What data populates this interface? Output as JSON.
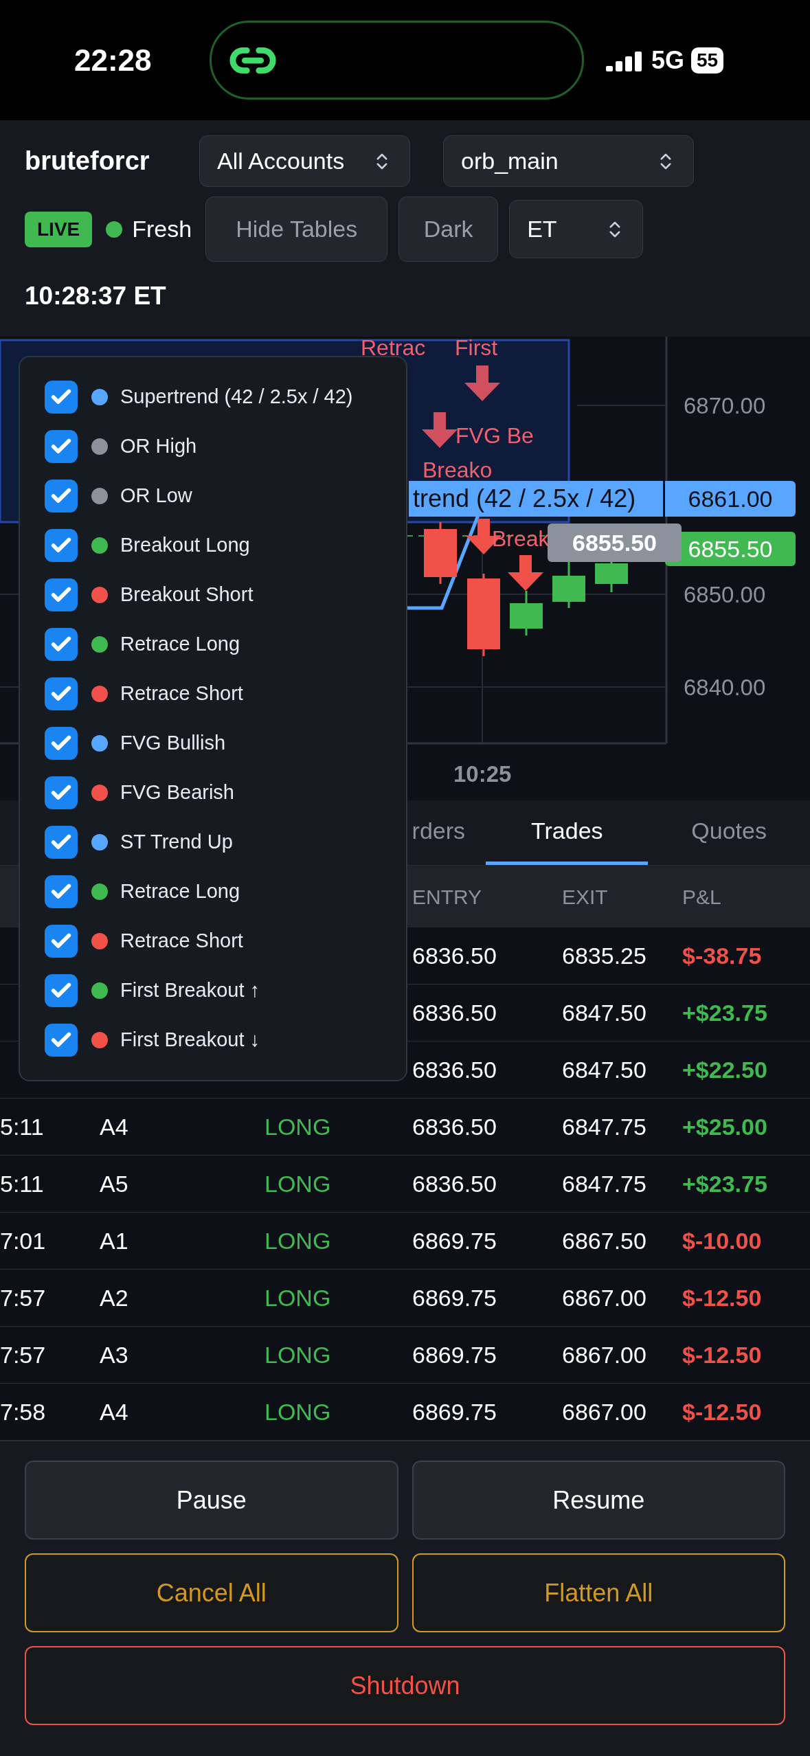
{
  "status_bar": {
    "time": "22:28",
    "network": "5G",
    "battery": "55"
  },
  "header": {
    "title": "bruteforcr",
    "account_select": "All Accounts",
    "strategy_select": "orb_main",
    "live_badge": "LIVE",
    "feed_status": "Fresh",
    "buttons": [
      "Hide Tables",
      "Dark"
    ],
    "timezone_select": "ET",
    "clock": "10:28:37 ET"
  },
  "chart": {
    "price_labels": [
      "6870.00",
      "6850.00",
      "6840.00"
    ],
    "x_labels": [
      "10:25"
    ],
    "supertrend_label": "trend (42 / 2.5x / 42)",
    "supertrend_price": "6861.00",
    "last_price": "6855.50",
    "crosshair_price": "6855.50",
    "markers": [
      "Retrac",
      "First",
      "FVG Be",
      "Breako",
      "Break"
    ]
  },
  "legend": {
    "items": [
      {
        "label": "Supertrend (42 / 2.5x / 42)",
        "color": "#58a6ff",
        "checked": true
      },
      {
        "label": "OR High",
        "color": "#8b929b",
        "checked": true
      },
      {
        "label": "OR Low",
        "color": "#8b929b",
        "checked": true
      },
      {
        "label": "Breakout Long",
        "color": "#3fb950",
        "checked": true
      },
      {
        "label": "Breakout Short",
        "color": "#f05249",
        "checked": true
      },
      {
        "label": "Retrace Long",
        "color": "#3fb950",
        "checked": true
      },
      {
        "label": "Retrace Short",
        "color": "#f05249",
        "checked": true
      },
      {
        "label": "FVG Bullish",
        "color": "#58a6ff",
        "checked": true
      },
      {
        "label": "FVG Bearish",
        "color": "#f05249",
        "checked": true
      },
      {
        "label": "ST Trend Up",
        "color": "#58a6ff",
        "checked": true
      },
      {
        "label": "Retrace Long",
        "color": "#3fb950",
        "checked": true
      },
      {
        "label": "Retrace Short",
        "color": "#f05249",
        "checked": true
      },
      {
        "label": "First Breakout ↑",
        "color": "#3fb950",
        "checked": true
      },
      {
        "label": "First Breakout ↓",
        "color": "#f05249",
        "checked": true
      }
    ]
  },
  "tabs": [
    {
      "label": "rders",
      "selected": false
    },
    {
      "label": "Trades",
      "selected": true
    },
    {
      "label": "Quotes",
      "selected": false
    }
  ],
  "table": {
    "columns": [
      "ENTRY",
      "EXIT",
      "P&L"
    ],
    "rows": [
      {
        "entry": "6836.50",
        "exit": "6835.25",
        "pnl": "$-38.75",
        "kind": "loss"
      },
      {
        "entry": "6836.50",
        "exit": "6847.50",
        "pnl": "+$23.75",
        "kind": "gain"
      },
      {
        "entry": "6836.50",
        "exit": "6847.50",
        "pnl": "+$22.50",
        "kind": "gain"
      },
      {
        "time": "5:11",
        "account": "A4",
        "side": "LONG",
        "entry": "6836.50",
        "exit": "6847.75",
        "pnl": "+$25.00",
        "kind": "gain"
      },
      {
        "time": "5:11",
        "account": "A5",
        "side": "LONG",
        "entry": "6836.50",
        "exit": "6847.75",
        "pnl": "+$23.75",
        "kind": "gain"
      },
      {
        "time": "7:01",
        "account": "A1",
        "side": "LONG",
        "entry": "6869.75",
        "exit": "6867.50",
        "pnl": "$-10.00",
        "kind": "loss"
      },
      {
        "time": "7:57",
        "account": "A2",
        "side": "LONG",
        "entry": "6869.75",
        "exit": "6867.00",
        "pnl": "$-12.50",
        "kind": "loss"
      },
      {
        "time": "7:57",
        "account": "A3",
        "side": "LONG",
        "entry": "6869.75",
        "exit": "6867.00",
        "pnl": "$-12.50",
        "kind": "loss"
      },
      {
        "time": "7:58",
        "account": "A4",
        "side": "LONG",
        "entry": "6869.75",
        "exit": "6867.00",
        "pnl": "$-12.50",
        "kind": "loss"
      }
    ]
  },
  "controls": [
    {
      "label": "Pause",
      "kind": "neutral"
    },
    {
      "label": "Resume",
      "kind": "neutral"
    },
    {
      "label": "Cancel All",
      "kind": "warning"
    },
    {
      "label": "Flatten All",
      "kind": "warning"
    },
    {
      "label": "Shutdown",
      "kind": "danger"
    }
  ]
}
